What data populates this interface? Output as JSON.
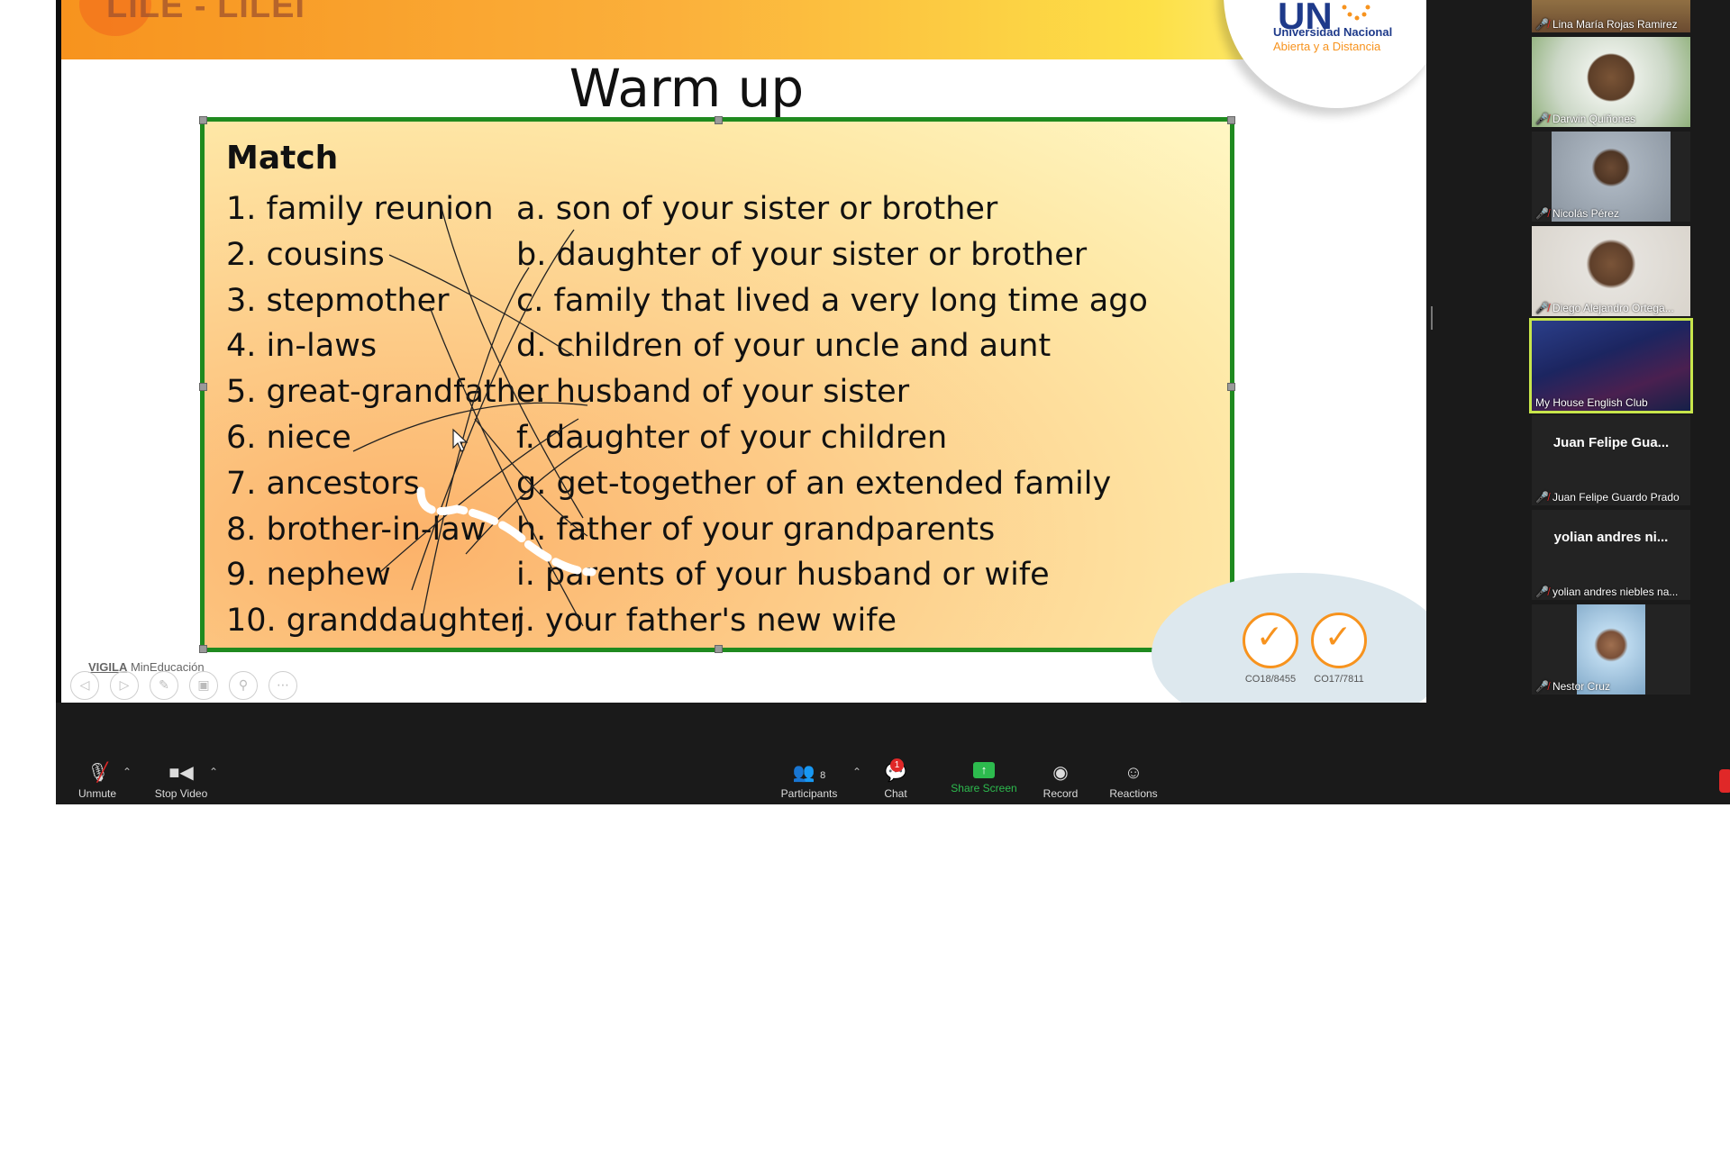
{
  "slide": {
    "banner_title": "LILE - LILEI",
    "university_mark": "UN",
    "university_name_1": "Universidad Nacional",
    "university_name_2": "Abierta y a Distancia",
    "title": "Warm up",
    "heading": "Match",
    "left_items": [
      "1. family reunion",
      "2. cousins",
      "3. stepmother",
      "4. in-laws",
      "5. great-grandfather",
      "6. niece",
      "7. ancestors",
      "8. brother-in-law",
      "9. nephew",
      "10. granddaughter"
    ],
    "right_items": [
      "a. son of your sister or brother",
      "b. daughter of your sister or brother",
      "c. family that lived a very long time ago",
      "d. children of your uncle and aunt",
      "e. husband of your sister",
      "f. daughter of your children",
      "g. get-together of an extended family",
      "h. father of your grandparents",
      "i. parents of your husband or wife",
      "j. your father's new wife"
    ],
    "footer_logo_1": "VIGILA",
    "footer_logo_2": "MinEducación",
    "cert_1": "CO18/8455",
    "cert_2": "CO17/7811"
  },
  "participants": [
    {
      "name": "Lina María Rojas Ramirez",
      "muted": true
    },
    {
      "name": "Darwin Quiñones",
      "muted": true
    },
    {
      "name": "Nicolás Pérez",
      "muted": true
    },
    {
      "name": "Diego Alejandro Ortega...",
      "muted": true
    },
    {
      "name": "My House English Club",
      "muted": false,
      "active": true
    },
    {
      "display": "Juan Felipe Gua...",
      "name": "Juan Felipe Guardo Prado",
      "muted": true
    },
    {
      "display": "yolian andres ni...",
      "name": "yolian andres niebles na...",
      "muted": true
    },
    {
      "name": "Nestor Cruz",
      "muted": true
    }
  ],
  "toolbar": {
    "unmute": "Unmute",
    "stop_video": "Stop Video",
    "participants": "Participants",
    "participants_count": "8",
    "chat": "Chat",
    "chat_badge": "1",
    "share_screen": "Share Screen",
    "record": "Record",
    "reactions": "Reactions"
  },
  "colors": {
    "accent_green": "#2dbb4e",
    "border_green": "#1f8a1f",
    "mute_red": "#e02828",
    "active_outline": "#c8e64b"
  }
}
